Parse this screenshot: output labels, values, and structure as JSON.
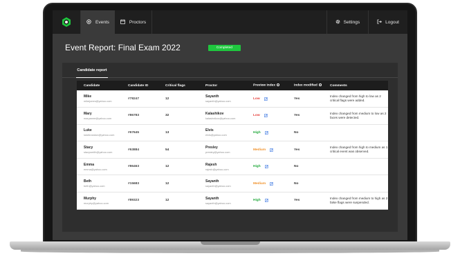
{
  "nav": {
    "events_label": "Events",
    "proctors_label": "Proctors",
    "settings_label": "Settings",
    "logout_label": "Logout"
  },
  "header": {
    "title": "Event Report:  Final Exam 2022",
    "status": "Completed"
  },
  "tabs": {
    "active": "Candidate report"
  },
  "table": {
    "columns": [
      "Candidate",
      "Candidate ID",
      "Critical flags",
      "Proctor",
      "Preview index",
      "Index modified",
      "Comments"
    ],
    "rows": [
      {
        "name": "Mike",
        "email": "mikejones@yahoo.com",
        "id": "#78247",
        "flags": "12",
        "proctor": "Sayanth",
        "proctor_email": "sayanth@yahoo.com",
        "index": "Low",
        "modified": "Yes",
        "comment": "Index changed from high to low as 2 critical flags were added."
      },
      {
        "name": "Mary",
        "email": "maryanne@yahoo.com",
        "id": "#86783",
        "flags": "32",
        "proctor": "Kalashikov",
        "proctor_email": "kalashnikov@yahoo.com",
        "index": "Low",
        "modified": "Yes",
        "comment": "Index changed from medium to low as 2 faces were detected."
      },
      {
        "name": "Luke",
        "email": "lukebrandon@yahoo.com",
        "id": "#67645",
        "flags": "13",
        "proctor": "Elvis",
        "proctor_email": "elvis@yahoo.com",
        "index": "High",
        "modified": "No",
        "comment": ""
      },
      {
        "name": "Stacy",
        "email": "stacysmith@yahoo.com",
        "id": "#63884",
        "flags": "54",
        "proctor": "Presley",
        "proctor_email": "presley@yahoo.com",
        "index": "Medium",
        "modified": "Yes",
        "comment": "Index changed from high to medium as 1 critical event was observed."
      },
      {
        "name": "Emma",
        "email": "emma@yahoo.com",
        "id": "#86463",
        "flags": "12",
        "proctor": "Rajesh",
        "proctor_email": "rajesh@yahoo.com",
        "index": "High",
        "modified": "No",
        "comment": ""
      },
      {
        "name": "Beth",
        "email": "beth@yahoo.com",
        "id": "#15683",
        "flags": "12",
        "proctor": "Sayanth",
        "proctor_email": "sayanth@yahoo.com",
        "index": "Medium",
        "modified": "No",
        "comment": ""
      },
      {
        "name": "Murphy",
        "email": "murphy@yahoo.com",
        "id": "#89323",
        "flags": "12",
        "proctor": "Sayanth",
        "proctor_email": "sayanth@yahoo.com",
        "index": "High",
        "modified": "Yes",
        "comment": "Index changed from medium to high as 2 false flags were suspended."
      }
    ]
  },
  "colors": {
    "low": "#e53935",
    "medium": "#f0912a",
    "high": "#1fa83a",
    "accent": "#1fc63e",
    "edit": "#2f6fe0"
  },
  "icons": [
    "logo-icon",
    "events-icon",
    "calendar-icon",
    "gear-icon",
    "logout-icon",
    "info-icon",
    "edit-icon"
  ]
}
